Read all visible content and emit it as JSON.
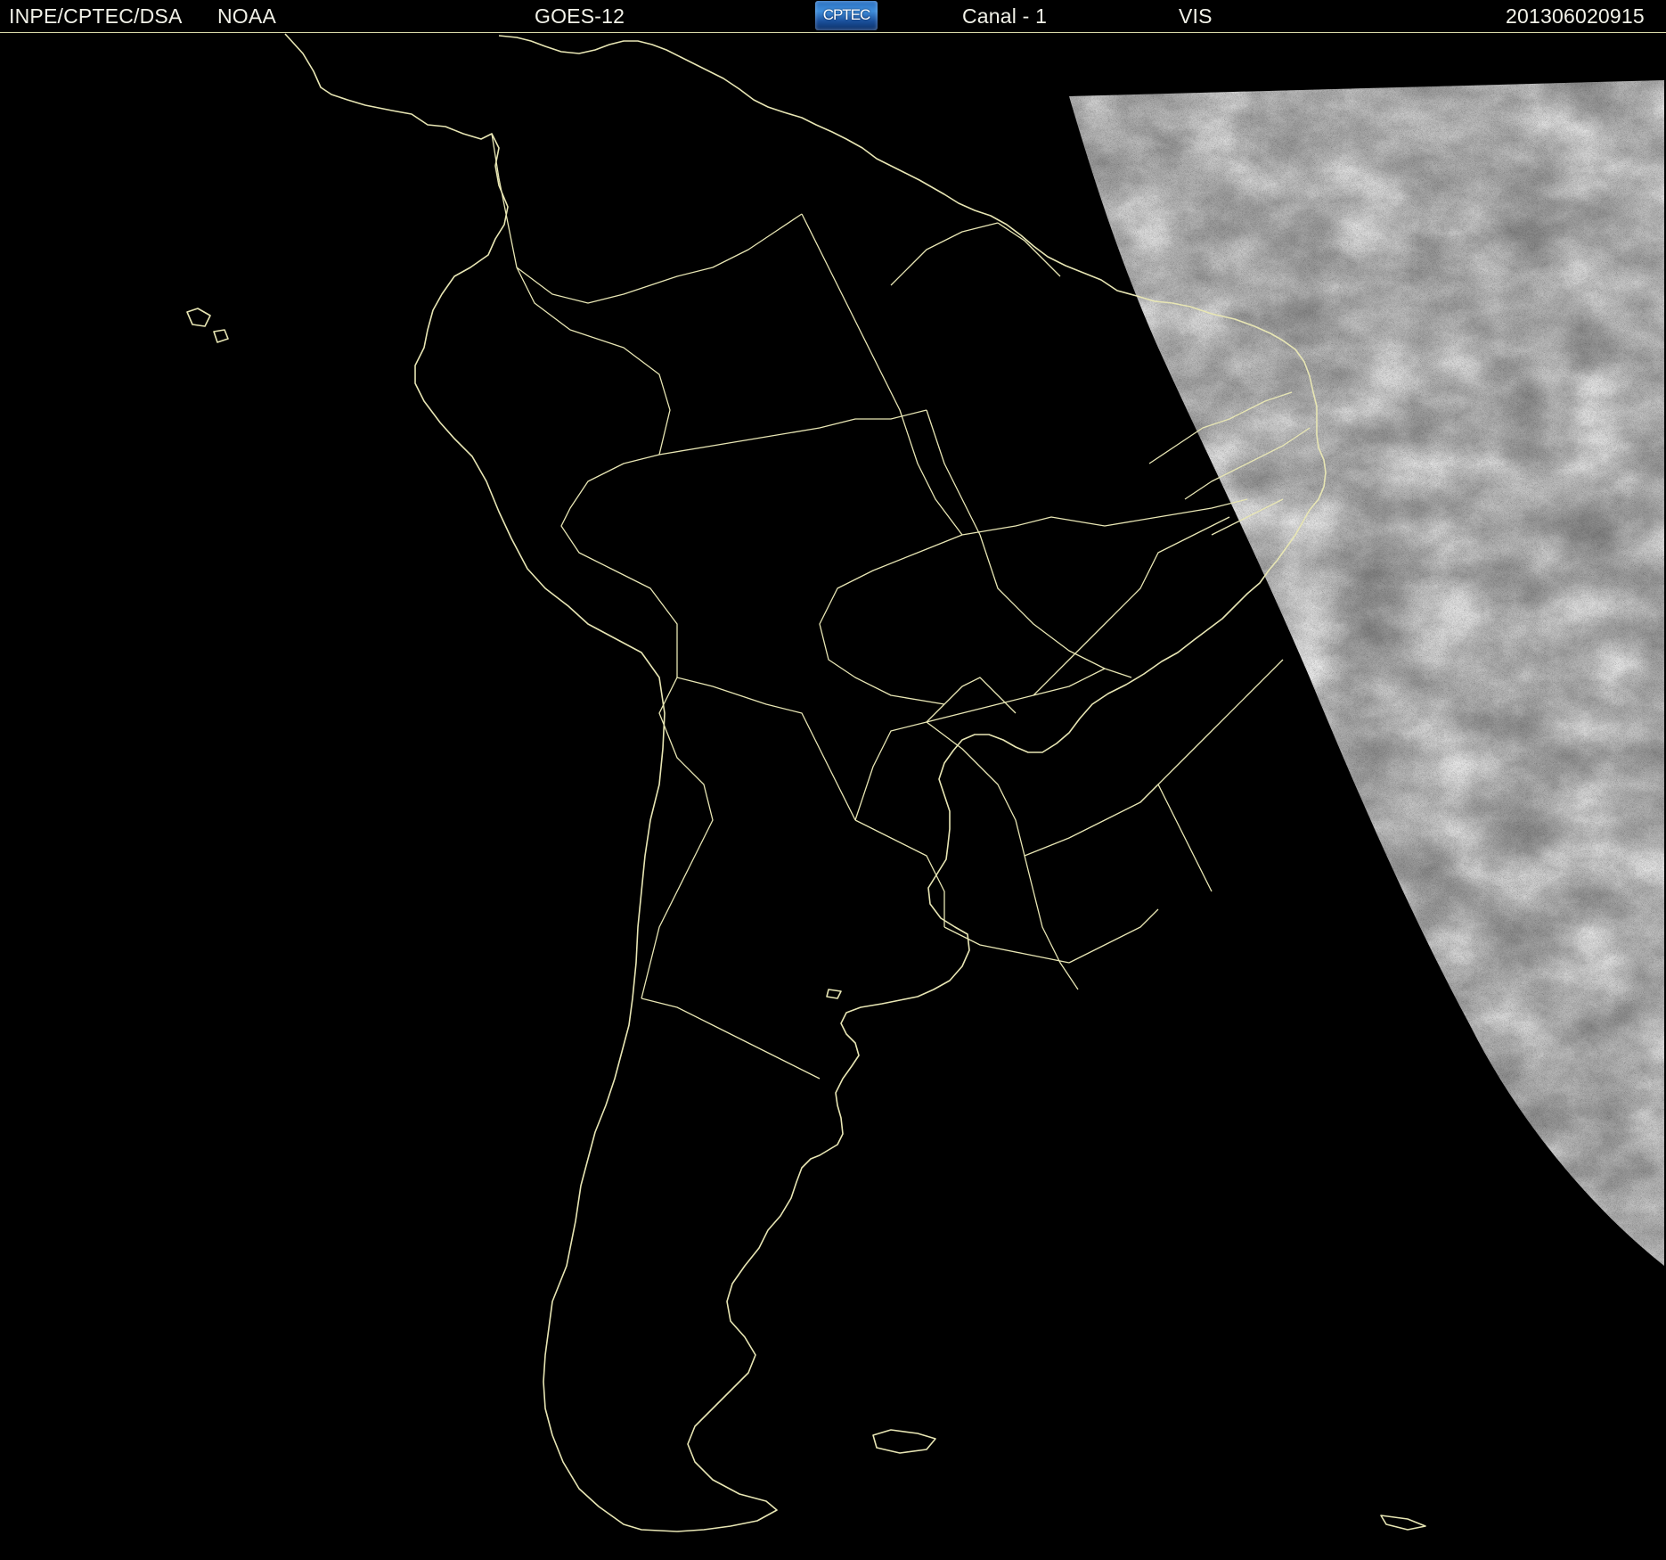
{
  "header": {
    "source": "INPE/CPTEC/DSA",
    "agency": "NOAA",
    "satellite": "GOES-12",
    "logo_text": "CPTEC",
    "channel": "Canal - 1",
    "band": "VIS",
    "timestamp": "201306020915"
  },
  "map": {
    "region": "South America",
    "line_color": "#e8e6b4",
    "background_color": "#000000"
  }
}
